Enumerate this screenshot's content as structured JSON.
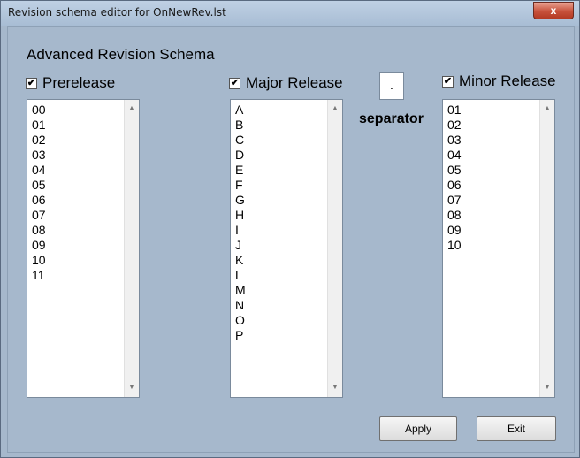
{
  "window": {
    "title": "Revision schema editor for OnNewRev.lst",
    "close_glyph": "x"
  },
  "heading": "Advanced Revision Schema",
  "prerelease": {
    "label": "Prerelease",
    "checked": true,
    "items": [
      "00",
      "01",
      "02",
      "03",
      "04",
      "05",
      "06",
      "07",
      "08",
      "09",
      "10",
      "11"
    ]
  },
  "major": {
    "label": "Major Release",
    "checked": true,
    "items": [
      "A",
      "B",
      "C",
      "D",
      "E",
      "F",
      "G",
      "H",
      "I",
      "J",
      "K",
      "L",
      "M",
      "N",
      "O",
      "P"
    ]
  },
  "separator": {
    "value": ".",
    "label": "separator"
  },
  "minor": {
    "label": "Minor Release",
    "checked": true,
    "items": [
      "01",
      "02",
      "03",
      "04",
      "05",
      "06",
      "07",
      "08",
      "09",
      "10"
    ]
  },
  "buttons": {
    "apply": "Apply",
    "exit": "Exit"
  },
  "glyphs": {
    "check": "✔",
    "scroll_up": "▲",
    "scroll_down": "▼"
  }
}
